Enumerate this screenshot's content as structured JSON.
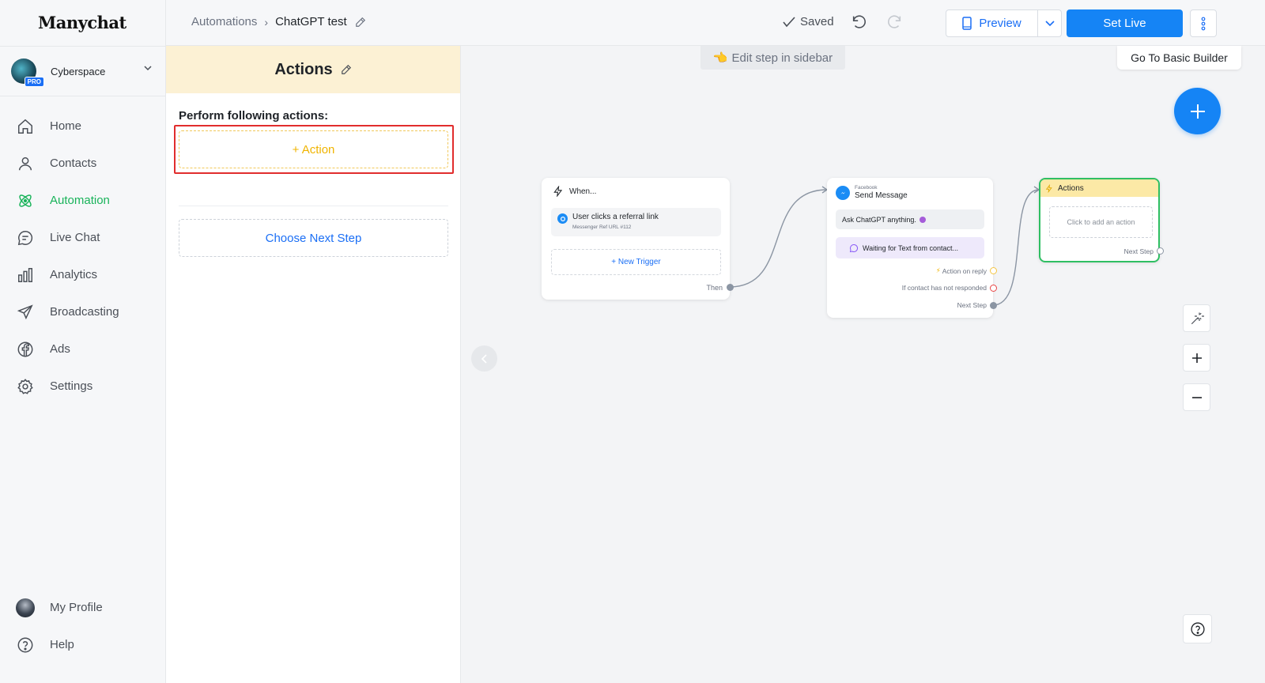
{
  "app": {
    "logo": "Manychat"
  },
  "account": {
    "name": "Cyberspace",
    "badge": "PRO"
  },
  "nav": {
    "items": [
      {
        "label": "Home"
      },
      {
        "label": "Contacts"
      },
      {
        "label": "Automation"
      },
      {
        "label": "Live Chat"
      },
      {
        "label": "Analytics"
      },
      {
        "label": "Broadcasting"
      },
      {
        "label": "Ads"
      },
      {
        "label": "Settings"
      }
    ],
    "bottom": [
      {
        "label": "My Profile"
      },
      {
        "label": "Help"
      }
    ],
    "active_color": "#19b35a"
  },
  "topbar": {
    "breadcrumb_root": "Automations",
    "breadcrumb_current": "ChatGPT test",
    "saved_label": "Saved",
    "preview_label": "Preview",
    "setlive_label": "Set Live",
    "accent": "#1584f5"
  },
  "panel": {
    "title": "Actions",
    "perform_label": "Perform following actions:",
    "add_action_label": "+ Action",
    "next_step_label": "Choose Next Step"
  },
  "canvas": {
    "hint": "Edit step in sidebar",
    "basic_builder": "Go To Basic Builder",
    "nodes": {
      "when": {
        "title": "When...",
        "trigger_label": "User clicks a referral link",
        "trigger_sub": "Messenger Ref URL #112",
        "new_trigger": "+ New Trigger",
        "then": "Then"
      },
      "send": {
        "source": "Facebook",
        "title": "Send Message",
        "message": "Ask ChatGPT anything.",
        "waiting": "Waiting for Text from contact...",
        "out_reply": "Action on reply",
        "out_noreply": "If contact has not responded",
        "out_next": "Next Step"
      },
      "actions": {
        "title": "Actions",
        "empty": "Click to add an action",
        "next": "Next Step"
      }
    }
  }
}
